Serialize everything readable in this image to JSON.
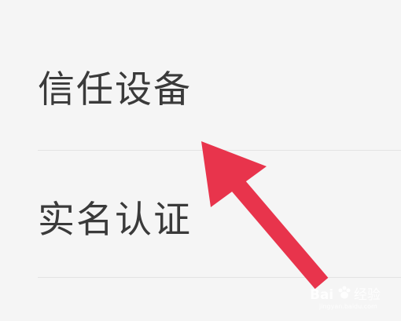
{
  "settings_list": {
    "items": [
      {
        "label": "信任设备"
      },
      {
        "label": "实名认证"
      }
    ]
  },
  "annotation": {
    "arrow_color": "#e8344c"
  },
  "watermark": {
    "text": "Bai 经验",
    "domain": "jingyan.baidu.com"
  },
  "colors": {
    "background": "#f5f5f5",
    "text": "#3a3a3a",
    "divider": "#e3e3e3"
  }
}
